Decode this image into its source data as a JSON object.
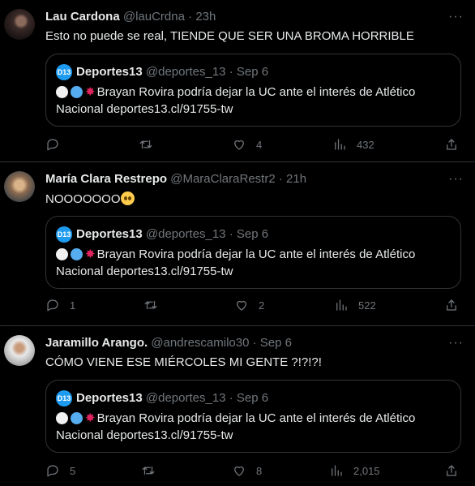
{
  "tweets": [
    {
      "name": "Lau Cardona",
      "handle": "@lauCrdna",
      "time": "23h",
      "text": "Esto no puede se real, TIENDE QUE SER UNA BROMA HORRIBLE",
      "quote": {
        "name": "Deportes13",
        "handle": "@deportes_13",
        "date": "Sep 6",
        "line1": "Brayan Rovira podría dejar la UC ante el interés de Atlético",
        "line2": "Nacional deportes13.cl/91755-tw"
      },
      "replies": "",
      "retweets": "",
      "likes": "4",
      "views": "432"
    },
    {
      "name": "María Clara Restrepo",
      "handle": "@MaraClaraRestr2",
      "time": "21h",
      "text": "NOOOOOOO",
      "quote": {
        "name": "Deportes13",
        "handle": "@deportes_13",
        "date": "Sep 6",
        "line1": "Brayan Rovira podría dejar la UC ante el interés de Atlético",
        "line2": "Nacional deportes13.cl/91755-tw"
      },
      "replies": "1",
      "retweets": "",
      "likes": "2",
      "views": "522"
    },
    {
      "name": "Jaramillo Arango.",
      "handle": "@andrescamilo30",
      "time": "Sep 6",
      "text": "CÓMO VIENE ESE MIÉRCOLES MI GENTE ?!?!?!",
      "quote": {
        "name": "Deportes13",
        "handle": "@deportes_13",
        "date": "Sep 6",
        "line1": "Brayan Rovira podría dejar la UC ante el interés de Atlético",
        "line2": "Nacional deportes13.cl/91755-tw"
      },
      "replies": "5",
      "retweets": "",
      "likes": "8",
      "views": "2,015"
    }
  ],
  "sep": "·",
  "more": "···",
  "logo_text": "D13",
  "icons": [
    "reply-icon",
    "retweet-icon",
    "like-icon",
    "views-icon",
    "share-icon",
    "more-icon"
  ],
  "colors": {
    "background": "#000000",
    "text": "#e7e9ea",
    "muted": "#71767b",
    "border": "#2f3336",
    "accent": "#1d9bf0"
  }
}
